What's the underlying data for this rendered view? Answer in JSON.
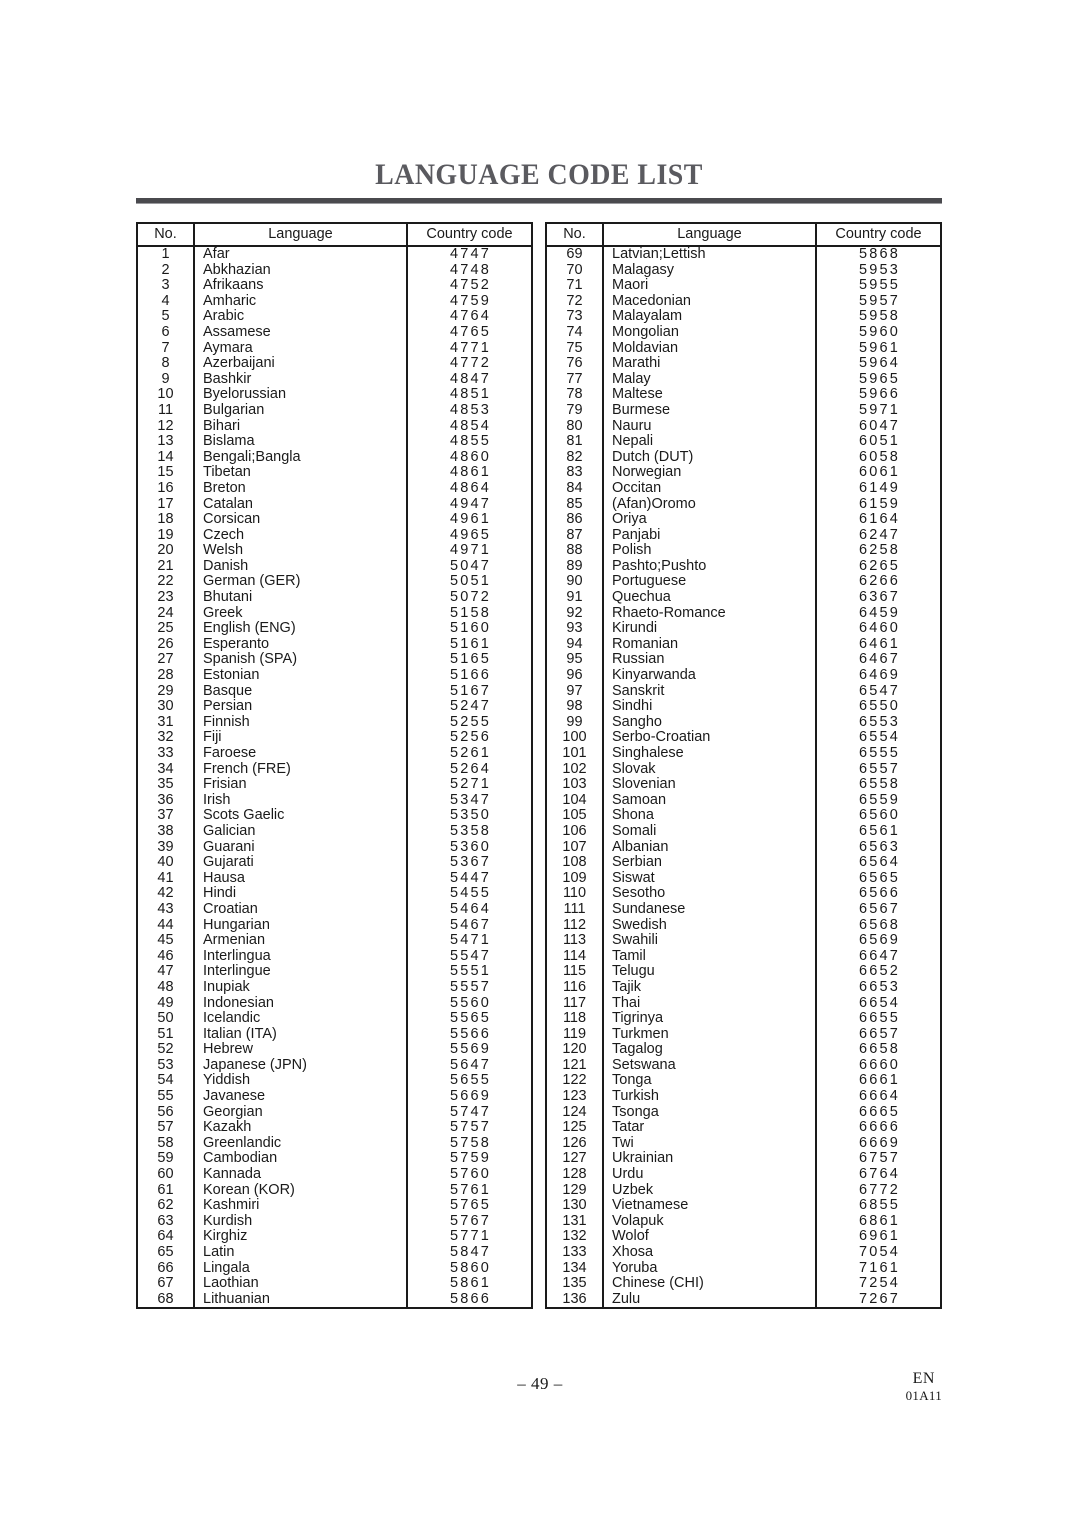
{
  "document": {
    "title": "LANGUAGE CODE LIST"
  },
  "table": {
    "headers": {
      "no": "No.",
      "language": "Language",
      "country_code": "Country code"
    },
    "left_column": [
      {
        "no": "1",
        "language": "Afar",
        "code": "4747"
      },
      {
        "no": "2",
        "language": "Abkhazian",
        "code": "4748"
      },
      {
        "no": "3",
        "language": "Afrikaans",
        "code": "4752"
      },
      {
        "no": "4",
        "language": "Amharic",
        "code": "4759"
      },
      {
        "no": "5",
        "language": "Arabic",
        "code": "4764"
      },
      {
        "no": "6",
        "language": "Assamese",
        "code": "4765"
      },
      {
        "no": "7",
        "language": "Aymara",
        "code": "4771"
      },
      {
        "no": "8",
        "language": "Azerbaijani",
        "code": "4772"
      },
      {
        "no": "9",
        "language": "Bashkir",
        "code": "4847"
      },
      {
        "no": "10",
        "language": "Byelorussian",
        "code": "4851"
      },
      {
        "no": "11",
        "language": "Bulgarian",
        "code": "4853"
      },
      {
        "no": "12",
        "language": "Bihari",
        "code": "4854"
      },
      {
        "no": "13",
        "language": "Bislama",
        "code": "4855"
      },
      {
        "no": "14",
        "language": "Bengali;Bangla",
        "code": "4860"
      },
      {
        "no": "15",
        "language": "Tibetan",
        "code": "4861"
      },
      {
        "no": "16",
        "language": "Breton",
        "code": "4864"
      },
      {
        "no": "17",
        "language": "Catalan",
        "code": "4947"
      },
      {
        "no": "18",
        "language": "Corsican",
        "code": "4961"
      },
      {
        "no": "19",
        "language": "Czech",
        "code": "4965"
      },
      {
        "no": "20",
        "language": "Welsh",
        "code": "4971"
      },
      {
        "no": "21",
        "language": "Danish",
        "code": "5047"
      },
      {
        "no": "22",
        "language": "German (GER)",
        "code": "5051"
      },
      {
        "no": "23",
        "language": "Bhutani",
        "code": "5072"
      },
      {
        "no": "24",
        "language": "Greek",
        "code": "5158"
      },
      {
        "no": "25",
        "language": "English (ENG)",
        "code": "5160"
      },
      {
        "no": "26",
        "language": "Esperanto",
        "code": "5161"
      },
      {
        "no": "27",
        "language": "Spanish (SPA)",
        "code": "5165"
      },
      {
        "no": "28",
        "language": "Estonian",
        "code": "5166"
      },
      {
        "no": "29",
        "language": "Basque",
        "code": "5167"
      },
      {
        "no": "30",
        "language": "Persian",
        "code": "5247"
      },
      {
        "no": "31",
        "language": "Finnish",
        "code": "5255"
      },
      {
        "no": "32",
        "language": "Fiji",
        "code": "5256"
      },
      {
        "no": "33",
        "language": "Faroese",
        "code": "5261"
      },
      {
        "no": "34",
        "language": "French (FRE)",
        "code": "5264"
      },
      {
        "no": "35",
        "language": "Frisian",
        "code": "5271"
      },
      {
        "no": "36",
        "language": "Irish",
        "code": "5347"
      },
      {
        "no": "37",
        "language": "Scots Gaelic",
        "code": "5350"
      },
      {
        "no": "38",
        "language": "Galician",
        "code": "5358"
      },
      {
        "no": "39",
        "language": "Guarani",
        "code": "5360"
      },
      {
        "no": "40",
        "language": "Gujarati",
        "code": "5367"
      },
      {
        "no": "41",
        "language": "Hausa",
        "code": "5447"
      },
      {
        "no": "42",
        "language": "Hindi",
        "code": "5455"
      },
      {
        "no": "43",
        "language": "Croatian",
        "code": "5464"
      },
      {
        "no": "44",
        "language": "Hungarian",
        "code": "5467"
      },
      {
        "no": "45",
        "language": "Armenian",
        "code": "5471"
      },
      {
        "no": "46",
        "language": "Interlingua",
        "code": "5547"
      },
      {
        "no": "47",
        "language": "Interlingue",
        "code": "5551"
      },
      {
        "no": "48",
        "language": "Inupiak",
        "code": "5557"
      },
      {
        "no": "49",
        "language": "Indonesian",
        "code": "5560"
      },
      {
        "no": "50",
        "language": "Icelandic",
        "code": "5565"
      },
      {
        "no": "51",
        "language": "Italian (ITA)",
        "code": "5566"
      },
      {
        "no": "52",
        "language": "Hebrew",
        "code": "5569"
      },
      {
        "no": "53",
        "language": "Japanese (JPN)",
        "code": "5647"
      },
      {
        "no": "54",
        "language": "Yiddish",
        "code": "5655"
      },
      {
        "no": "55",
        "language": "Javanese",
        "code": "5669"
      },
      {
        "no": "56",
        "language": "Georgian",
        "code": "5747"
      },
      {
        "no": "57",
        "language": "Kazakh",
        "code": "5757"
      },
      {
        "no": "58",
        "language": "Greenlandic",
        "code": "5758"
      },
      {
        "no": "59",
        "language": "Cambodian",
        "code": "5759"
      },
      {
        "no": "60",
        "language": "Kannada",
        "code": "5760"
      },
      {
        "no": "61",
        "language": "Korean (KOR)",
        "code": "5761"
      },
      {
        "no": "62",
        "language": "Kashmiri",
        "code": "5765"
      },
      {
        "no": "63",
        "language": "Kurdish",
        "code": "5767"
      },
      {
        "no": "64",
        "language": "Kirghiz",
        "code": "5771"
      },
      {
        "no": "65",
        "language": "Latin",
        "code": "5847"
      },
      {
        "no": "66",
        "language": "Lingala",
        "code": "5860"
      },
      {
        "no": "67",
        "language": "Laothian",
        "code": "5861"
      },
      {
        "no": "68",
        "language": "Lithuanian",
        "code": "5866"
      }
    ],
    "right_column": [
      {
        "no": "69",
        "language": "Latvian;Lettish",
        "code": "5868"
      },
      {
        "no": "70",
        "language": "Malagasy",
        "code": "5953"
      },
      {
        "no": "71",
        "language": "Maori",
        "code": "5955"
      },
      {
        "no": "72",
        "language": "Macedonian",
        "code": "5957"
      },
      {
        "no": "73",
        "language": "Malayalam",
        "code": "5958"
      },
      {
        "no": "74",
        "language": "Mongolian",
        "code": "5960"
      },
      {
        "no": "75",
        "language": "Moldavian",
        "code": "5961"
      },
      {
        "no": "76",
        "language": "Marathi",
        "code": "5964"
      },
      {
        "no": "77",
        "language": "Malay",
        "code": "5965"
      },
      {
        "no": "78",
        "language": "Maltese",
        "code": "5966"
      },
      {
        "no": "79",
        "language": "Burmese",
        "code": "5971"
      },
      {
        "no": "80",
        "language": "Nauru",
        "code": "6047"
      },
      {
        "no": "81",
        "language": "Nepali",
        "code": "6051"
      },
      {
        "no": "82",
        "language": "Dutch (DUT)",
        "code": "6058"
      },
      {
        "no": "83",
        "language": "Norwegian",
        "code": "6061"
      },
      {
        "no": "84",
        "language": "Occitan",
        "code": "6149"
      },
      {
        "no": "85",
        "language": "(Afan)Oromo",
        "code": "6159"
      },
      {
        "no": "86",
        "language": "Oriya",
        "code": "6164"
      },
      {
        "no": "87",
        "language": "Panjabi",
        "code": "6247"
      },
      {
        "no": "88",
        "language": "Polish",
        "code": "6258"
      },
      {
        "no": "89",
        "language": "Pashto;Pushto",
        "code": "6265"
      },
      {
        "no": "90",
        "language": "Portuguese",
        "code": "6266"
      },
      {
        "no": "91",
        "language": "Quechua",
        "code": "6367"
      },
      {
        "no": "92",
        "language": "Rhaeto-Romance",
        "code": "6459"
      },
      {
        "no": "93",
        "language": "Kirundi",
        "code": "6460"
      },
      {
        "no": "94",
        "language": "Romanian",
        "code": "6461"
      },
      {
        "no": "95",
        "language": "Russian",
        "code": "6467"
      },
      {
        "no": "96",
        "language": "Kinyarwanda",
        "code": "6469"
      },
      {
        "no": "97",
        "language": "Sanskrit",
        "code": "6547"
      },
      {
        "no": "98",
        "language": "Sindhi",
        "code": "6550"
      },
      {
        "no": "99",
        "language": "Sangho",
        "code": "6553"
      },
      {
        "no": "100",
        "language": "Serbo-Croatian",
        "code": "6554"
      },
      {
        "no": "101",
        "language": "Singhalese",
        "code": "6555"
      },
      {
        "no": "102",
        "language": "Slovak",
        "code": "6557"
      },
      {
        "no": "103",
        "language": "Slovenian",
        "code": "6558"
      },
      {
        "no": "104",
        "language": "Samoan",
        "code": "6559"
      },
      {
        "no": "105",
        "language": "Shona",
        "code": "6560"
      },
      {
        "no": "106",
        "language": "Somali",
        "code": "6561"
      },
      {
        "no": "107",
        "language": "Albanian",
        "code": "6563"
      },
      {
        "no": "108",
        "language": "Serbian",
        "code": "6564"
      },
      {
        "no": "109",
        "language": "Siswat",
        "code": "6565"
      },
      {
        "no": "110",
        "language": "Sesotho",
        "code": "6566"
      },
      {
        "no": "111",
        "language": "Sundanese",
        "code": "6567"
      },
      {
        "no": "112",
        "language": "Swedish",
        "code": "6568"
      },
      {
        "no": "113",
        "language": "Swahili",
        "code": "6569"
      },
      {
        "no": "114",
        "language": "Tamil",
        "code": "6647"
      },
      {
        "no": "115",
        "language": "Telugu",
        "code": "6652"
      },
      {
        "no": "116",
        "language": "Tajik",
        "code": "6653"
      },
      {
        "no": "117",
        "language": "Thai",
        "code": "6654"
      },
      {
        "no": "118",
        "language": "Tigrinya",
        "code": "6655"
      },
      {
        "no": "119",
        "language": "Turkmen",
        "code": "6657"
      },
      {
        "no": "120",
        "language": "Tagalog",
        "code": "6658"
      },
      {
        "no": "121",
        "language": "Setswana",
        "code": "6660"
      },
      {
        "no": "122",
        "language": "Tonga",
        "code": "6661"
      },
      {
        "no": "123",
        "language": "Turkish",
        "code": "6664"
      },
      {
        "no": "124",
        "language": "Tsonga",
        "code": "6665"
      },
      {
        "no": "125",
        "language": "Tatar",
        "code": "6666"
      },
      {
        "no": "126",
        "language": "Twi",
        "code": "6669"
      },
      {
        "no": "127",
        "language": "Ukrainian",
        "code": "6757"
      },
      {
        "no": "128",
        "language": "Urdu",
        "code": "6764"
      },
      {
        "no": "129",
        "language": "Uzbek",
        "code": "6772"
      },
      {
        "no": "130",
        "language": "Vietnamese",
        "code": "6855"
      },
      {
        "no": "131",
        "language": "Volapuk",
        "code": "6861"
      },
      {
        "no": "132",
        "language": "Wolof",
        "code": "6961"
      },
      {
        "no": "133",
        "language": "Xhosa",
        "code": "7054"
      },
      {
        "no": "134",
        "language": "Yoruba",
        "code": "7161"
      },
      {
        "no": "135",
        "language": "Chinese (CHI)",
        "code": "7254"
      },
      {
        "no": "136",
        "language": "Zulu",
        "code": "7267"
      }
    ]
  },
  "footer": {
    "page_number": "– 49 –",
    "language_marker": "EN",
    "document_code": "01A11"
  }
}
